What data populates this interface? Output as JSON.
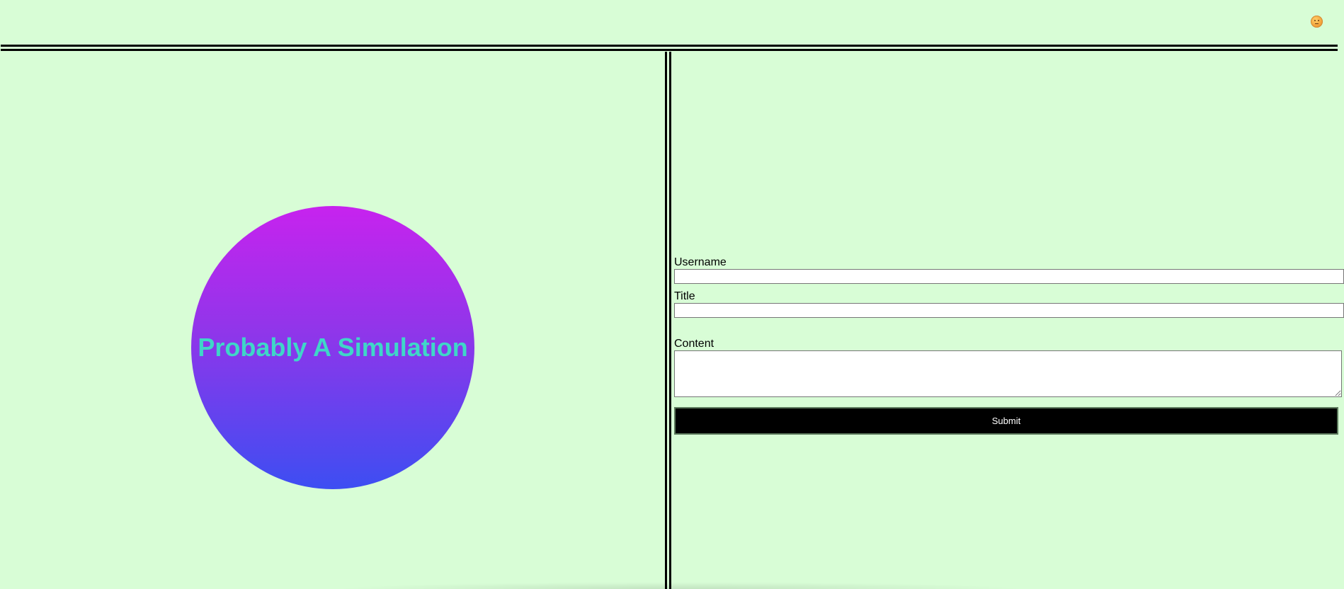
{
  "header": {
    "avatar_icon": "slightly-smiling-emoji-icon"
  },
  "hero": {
    "title": "Probably A Simulation",
    "gradient_top": "#c723ee",
    "gradient_bottom": "#3d4ef2",
    "title_color": "#3fd6c8"
  },
  "form": {
    "username_label": "Username",
    "username_value": "",
    "title_label": "Title",
    "title_value": "",
    "content_label": "Content",
    "content_value": "",
    "submit_label": "Submit"
  },
  "theme": {
    "background": "#d8fdd6"
  }
}
